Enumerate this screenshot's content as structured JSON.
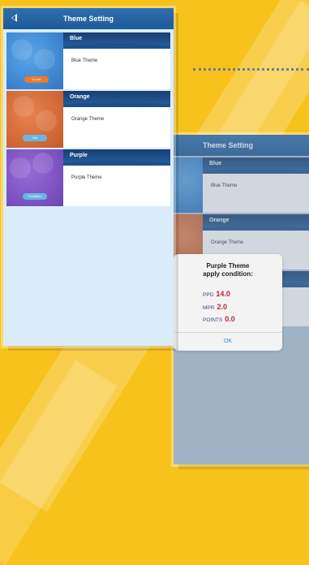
{
  "left_screen": {
    "title": "Theme Setting",
    "themes": [
      {
        "name": "Blue",
        "description": "Blue Theme",
        "button": "In use"
      },
      {
        "name": "Orange",
        "description": "Orange Theme",
        "button": "Set"
      },
      {
        "name": "Purple",
        "description": "Purple Theme",
        "button": "Condition"
      }
    ]
  },
  "right_screen": {
    "title": "Theme Setting",
    "themes": [
      {
        "name": "Blue",
        "description": "Blue Theme"
      },
      {
        "name": "Orange",
        "description": "Orange Theme"
      }
    ]
  },
  "dialog": {
    "title_line1": "Purple Theme",
    "title_line2": "apply condition:",
    "stats": [
      {
        "label": "PPD",
        "value": "14.0"
      },
      {
        "label": "MPR",
        "value": "2.0"
      },
      {
        "label": "POINTS",
        "value": "0.0"
      }
    ],
    "ok_label": "OK"
  },
  "colors": {
    "background": "#f7c21c",
    "titlebar": "#2b6aab",
    "accent_red": "#c0233a",
    "ok_blue": "#3a86d6"
  }
}
